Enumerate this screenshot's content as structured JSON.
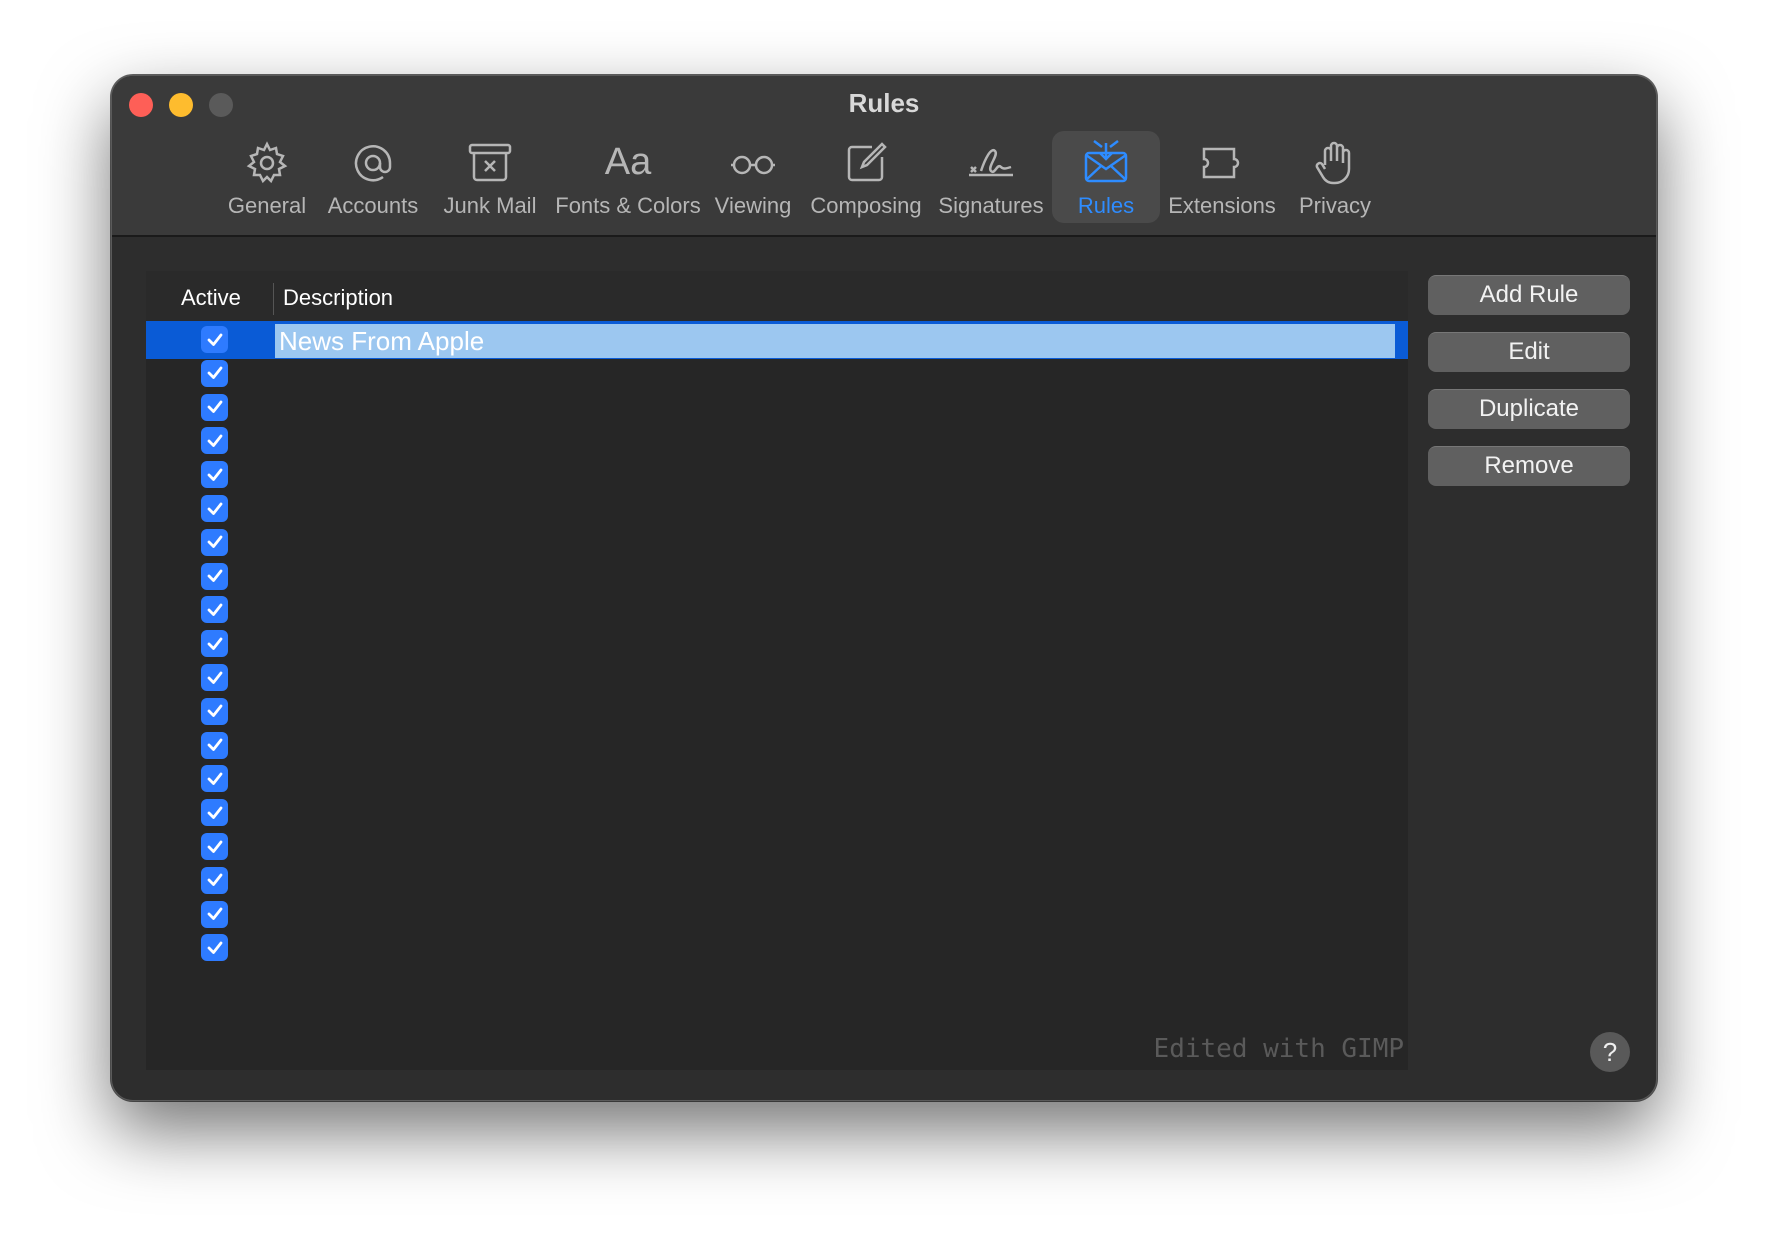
{
  "window": {
    "title": "Rules"
  },
  "toolbar": {
    "items": [
      {
        "label": "General",
        "icon": "gear-icon"
      },
      {
        "label": "Accounts",
        "icon": "at-sign-icon"
      },
      {
        "label": "Junk Mail",
        "icon": "junk-mail-icon"
      },
      {
        "label": "Fonts & Colors",
        "icon": "fonts-icon",
        "glyph": "Aa"
      },
      {
        "label": "Viewing",
        "icon": "glasses-icon"
      },
      {
        "label": "Composing",
        "icon": "compose-icon"
      },
      {
        "label": "Signatures",
        "icon": "signature-icon"
      },
      {
        "label": "Rules",
        "icon": "rules-envelope-icon"
      },
      {
        "label": "Extensions",
        "icon": "puzzle-icon"
      },
      {
        "label": "Privacy",
        "icon": "hand-icon"
      }
    ],
    "active": "Rules",
    "accent_color": "#2e8cff"
  },
  "rules_list": {
    "columns": {
      "active": "Active",
      "description": "Description"
    },
    "rows": [
      {
        "active": true,
        "description": "News From Apple",
        "selected": true
      },
      {
        "active": true,
        "description": ""
      },
      {
        "active": true,
        "description": ""
      },
      {
        "active": true,
        "description": ""
      },
      {
        "active": true,
        "description": ""
      },
      {
        "active": true,
        "description": ""
      },
      {
        "active": true,
        "description": ""
      },
      {
        "active": true,
        "description": ""
      },
      {
        "active": true,
        "description": ""
      },
      {
        "active": true,
        "description": ""
      },
      {
        "active": true,
        "description": ""
      },
      {
        "active": true,
        "description": ""
      },
      {
        "active": true,
        "description": ""
      },
      {
        "active": true,
        "description": ""
      },
      {
        "active": true,
        "description": ""
      },
      {
        "active": true,
        "description": ""
      },
      {
        "active": true,
        "description": ""
      },
      {
        "active": true,
        "description": ""
      },
      {
        "active": true,
        "description": ""
      }
    ],
    "watermark": "Edited with GIMP"
  },
  "buttons": {
    "add_rule": "Add Rule",
    "edit": "Edit",
    "duplicate": "Duplicate",
    "remove": "Remove",
    "help": "?"
  },
  "colors": {
    "selection": "#0a5bd6",
    "checkbox": "#2e7bff",
    "close": "#fe5f57",
    "minimize": "#febc2e"
  }
}
